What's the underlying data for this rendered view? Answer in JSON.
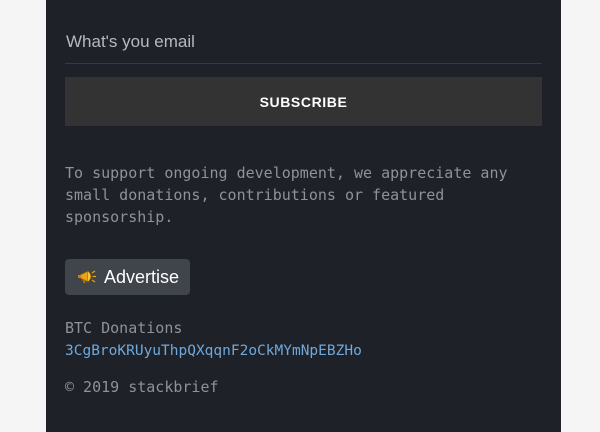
{
  "newsletter": {
    "email_placeholder": "What's you email",
    "subscribe_label": "SUBSCRIBE"
  },
  "support": {
    "text": "To support ongoing development, we appreciate any small donations, contributions or featured sponsorship."
  },
  "advertise": {
    "icon": "megaphone-icon",
    "label": "Advertise"
  },
  "btc": {
    "label": "BTC Donations",
    "address": "3CgBroKRUyuThpQXqqnF2oCkMYmNpEBZHo"
  },
  "footer": {
    "copyright": "© 2019 stackbrief"
  },
  "colors": {
    "panel_bg": "#1e2127",
    "button_bg": "#333333",
    "link": "#6fa8dc",
    "muted_text": "#8d929b"
  }
}
